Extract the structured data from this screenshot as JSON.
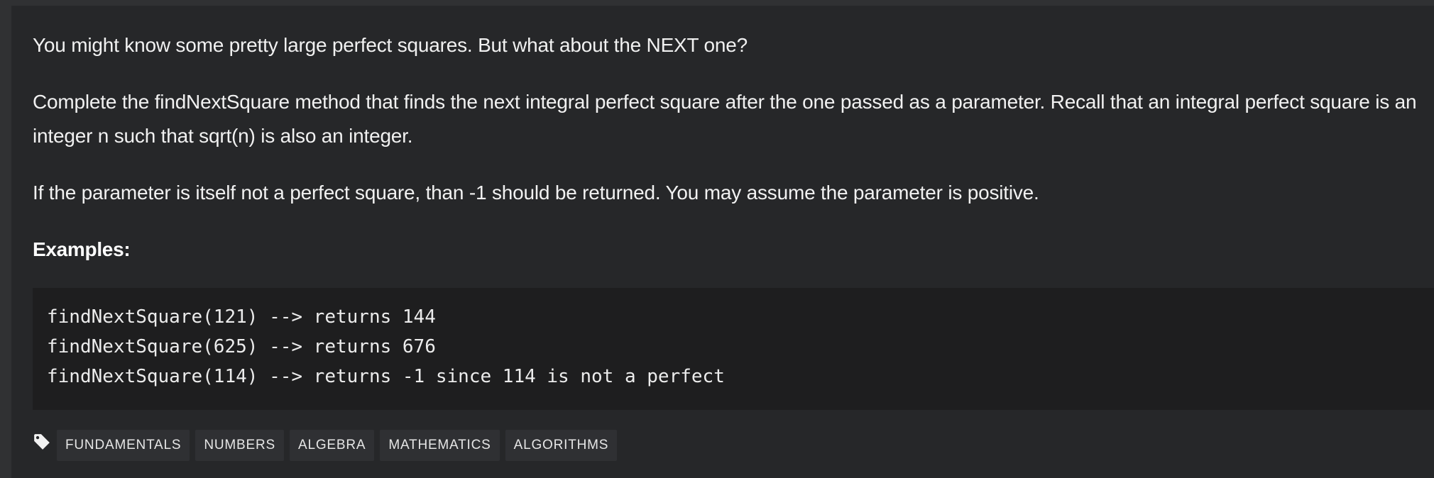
{
  "description": {
    "paragraph1": "You might know some pretty large perfect squares. But what about the NEXT one?",
    "paragraph2": "Complete the findNextSquare method that finds the next integral perfect square after the one passed as a parameter. Recall that an integral perfect square is an integer n such that sqrt(n) is also an integer.",
    "paragraph3": "If the parameter is itself not a perfect square, than -1 should be returned. You may assume the parameter is positive.",
    "examples_heading": "Examples:"
  },
  "code_examples": [
    "findNextSquare(121) --> returns 144",
    "findNextSquare(625) --> returns 676",
    "findNextSquare(114) --> returns -1 since 114 is not a perfect"
  ],
  "tags": {
    "icon": "tag-icon",
    "items": [
      "FUNDAMENTALS",
      "NUMBERS",
      "ALGEBRA",
      "MATHEMATICS",
      "ALGORITHMS"
    ]
  },
  "colors": {
    "page_background": "#303133",
    "panel_background": "#262729",
    "code_background": "#1e1e1f",
    "tag_background": "#2f3033",
    "text": "#f1f1f1"
  }
}
